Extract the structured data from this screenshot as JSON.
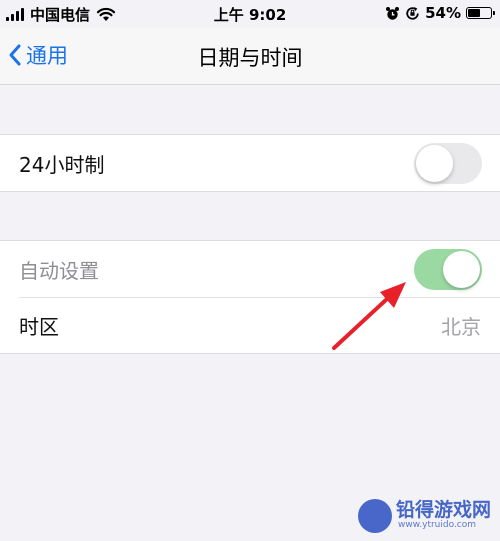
{
  "status_bar": {
    "carrier": "中国电信",
    "time": "上午 9:02",
    "battery_text": "54%",
    "battery_level": 0.54
  },
  "nav": {
    "back_label": "通用",
    "title": "日期与时间"
  },
  "settings": {
    "hour24": {
      "label": "24小时制",
      "enabled": false
    },
    "auto_set": {
      "label": "自动设置",
      "enabled": true
    },
    "timezone": {
      "label": "时区",
      "value": "北京"
    }
  },
  "watermark": {
    "text": "铅得游戏网",
    "url": "www.ytruido.com"
  },
  "colors": {
    "accent": "#1a73e8",
    "toggle_on": "#9bd9a3",
    "toggle_off": "#e9e9eb",
    "annotation_arrow": "#e8202a"
  },
  "icons": [
    "signal-icon",
    "wifi-icon",
    "alarm-icon",
    "orientation-lock-icon",
    "battery-icon",
    "chevron-left-icon",
    "arrow-annotation-icon",
    "watermark-logo-icon"
  ]
}
